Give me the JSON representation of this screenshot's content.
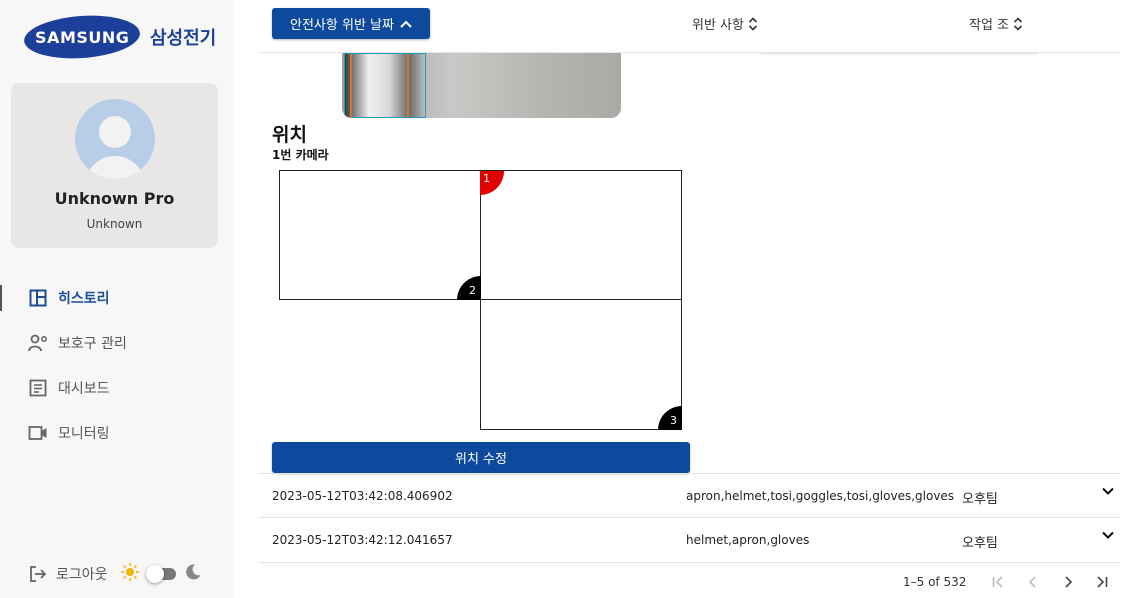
{
  "brand": {
    "logo_text": "SAMSUNG",
    "ko_name": "삼성전기",
    "color": "#1c3f9a"
  },
  "profile": {
    "name": "Unknown Pro",
    "role": "Unknown"
  },
  "nav": {
    "items": [
      {
        "label": "히스토리",
        "icon": "dashboard-layout-icon",
        "active": true
      },
      {
        "label": "보호구 관리",
        "icon": "user-gear-icon",
        "active": false
      },
      {
        "label": "대시보드",
        "icon": "list-document-icon",
        "active": false
      },
      {
        "label": "모니터링",
        "icon": "video-camera-icon",
        "active": false
      }
    ],
    "logout_label": "로그아웃"
  },
  "header": {
    "date_button": "안전사항 위반 날짜",
    "violation_col": "위반 사항",
    "team_col": "작업 조"
  },
  "detail": {
    "location_title": "위치",
    "camera_label": "1번 카메라",
    "zones": [
      "1",
      "2",
      "3"
    ],
    "edit_button": "위치 수정"
  },
  "rows": [
    {
      "timestamp": "2023-05-12T03:42:08.406902",
      "violations": "apron,helmet,tosi,goggles,tosi,gloves,gloves",
      "team": "오후팀"
    },
    {
      "timestamp": "2023-05-12T03:42:12.041657",
      "violations": "helmet,apron,gloves",
      "team": "오후팀"
    }
  ],
  "pagination": {
    "info": "1–5 of 532"
  },
  "colors": {
    "primary": "#0d4a9d",
    "zone1": "#e00000",
    "zone_other": "#000000"
  }
}
